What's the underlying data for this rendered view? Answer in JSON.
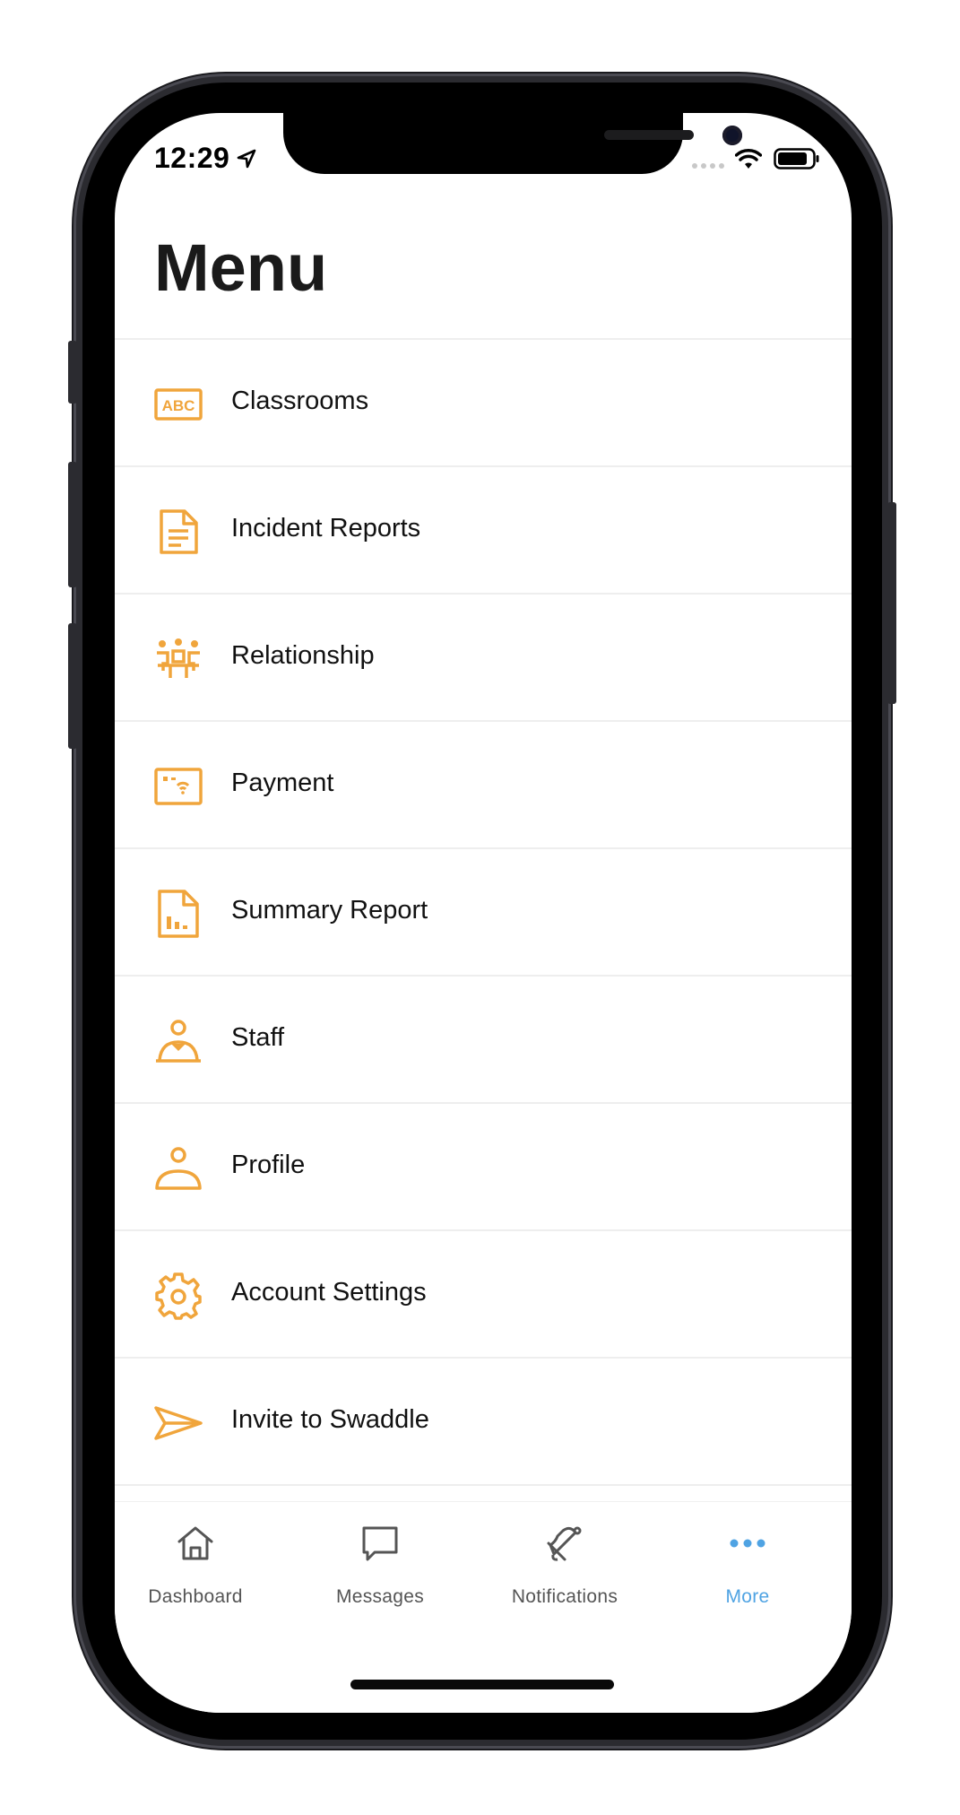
{
  "status_bar": {
    "time": "12:29"
  },
  "header": {
    "title": "Menu"
  },
  "menu": {
    "items": [
      {
        "label": "Classrooms",
        "icon": "classroom-abc-icon",
        "icon_text": "ABC"
      },
      {
        "label": "Incident Reports",
        "icon": "document-icon"
      },
      {
        "label": "Relationship",
        "icon": "people-group-icon"
      },
      {
        "label": "Payment",
        "icon": "payment-card-icon"
      },
      {
        "label": "Summary Report",
        "icon": "chart-file-icon"
      },
      {
        "label": "Staff",
        "icon": "staff-person-icon"
      },
      {
        "label": "Profile",
        "icon": "profile-person-icon"
      },
      {
        "label": "Account Settings",
        "icon": "gear-icon"
      },
      {
        "label": "Invite to Swaddle",
        "icon": "send-icon"
      }
    ]
  },
  "tab_bar": {
    "tabs": [
      {
        "label": "Dashboard",
        "icon": "home-icon",
        "active": false
      },
      {
        "label": "Messages",
        "icon": "message-icon",
        "active": false
      },
      {
        "label": "Notifications",
        "icon": "bell-icon",
        "active": false
      },
      {
        "label": "More",
        "icon": "more-dots-icon",
        "active": true
      }
    ]
  },
  "colors": {
    "accent_orange": "#F0A53C",
    "active_tab_blue": "#4FA3E3",
    "inactive_tab": "#555555"
  }
}
